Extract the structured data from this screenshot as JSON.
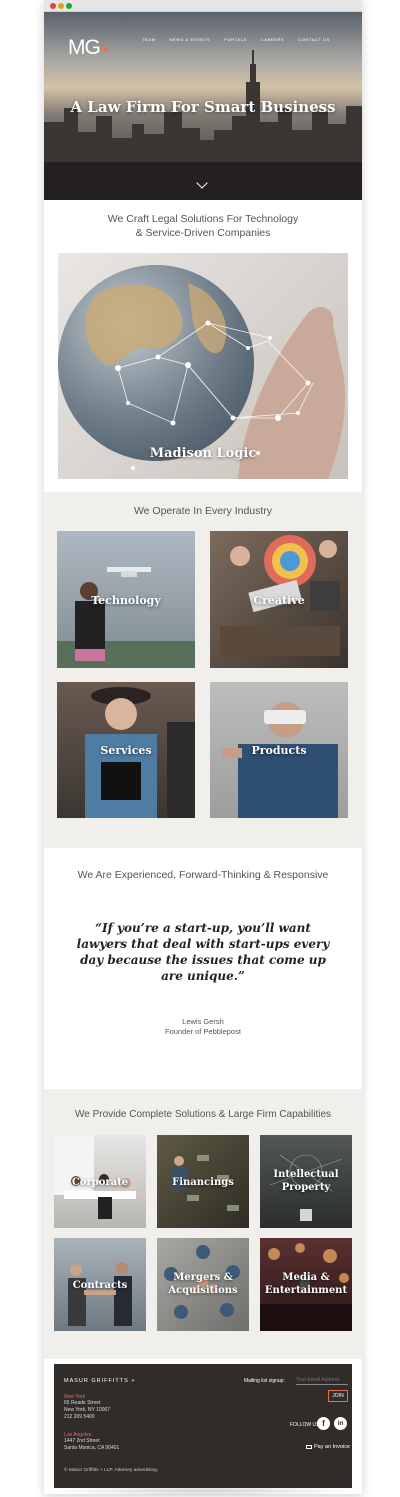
{
  "browser": {
    "dots": [
      "close",
      "minimize",
      "maximize"
    ]
  },
  "hero": {
    "logo_text": "MG",
    "logo_plus": "+",
    "nav": [
      "TEAM",
      "NEWS & EVENTS",
      "PORTALS",
      "CAREERS",
      "CONTACT US"
    ],
    "title": "A Law Firm For Smart Business",
    "scroll_icon": "chevron-down-icon"
  },
  "intro": {
    "heading_line1": "We Craft Legal Solutions For Technology",
    "heading_line2": "& Service-Driven Companies",
    "feature_title": "Madison Logic"
  },
  "industries": {
    "heading": "We Operate In Every Industry",
    "tiles": [
      "Technology",
      "Creative",
      "Services",
      "Products"
    ]
  },
  "testimonial": {
    "heading": "We Are Experienced, Forward-Thinking & Responsive",
    "quote": "“If you’re a start-up, you’ll want lawyers that deal with start-ups every day because the issues that come up are unique.”",
    "name": "Lewis Gersh",
    "role": "Founder of Pebblepost"
  },
  "capabilities": {
    "heading": "We Provide Complete Solutions & Large Firm Capabilities",
    "tiles": [
      {
        "line1": "Corporate",
        "line2": ""
      },
      {
        "line1": "Financings",
        "line2": ""
      },
      {
        "line1": "Intellectual",
        "line2": "Property"
      },
      {
        "line1": "Contracts",
        "line2": ""
      },
      {
        "line1": "Mergers &",
        "line2": "Acquisitions"
      },
      {
        "line1": "Media &",
        "line2": "Entertainment"
      }
    ]
  },
  "footer": {
    "brand": "MASUR GRIFFITTS +",
    "offices": [
      {
        "city": "New York",
        "line1": "65 Reade Street",
        "line2": "New York, NY 10007",
        "line3": "212 209 5400"
      },
      {
        "city": "Los Angeles",
        "line1": "1447 2nd Street",
        "line2": "Santa Monica, CA 90401",
        "line3": ""
      }
    ],
    "mailing_label": "Mailing list signup:",
    "email_placeholder": "Your Email Address",
    "join_label": "JOIN",
    "follow_label": "FOLLOW US",
    "social": [
      {
        "name": "facebook-icon",
        "glyph": "f"
      },
      {
        "name": "linkedin-icon",
        "glyph": "in"
      }
    ],
    "pay_label": "Pay an Invoice",
    "copyright": "© Masur Griffitts + LLP. Attorney advertising."
  },
  "colors": {
    "accent": "#e76d5c",
    "footer_bg": "#2f2c2a",
    "section_gray": "#f0efeb"
  }
}
